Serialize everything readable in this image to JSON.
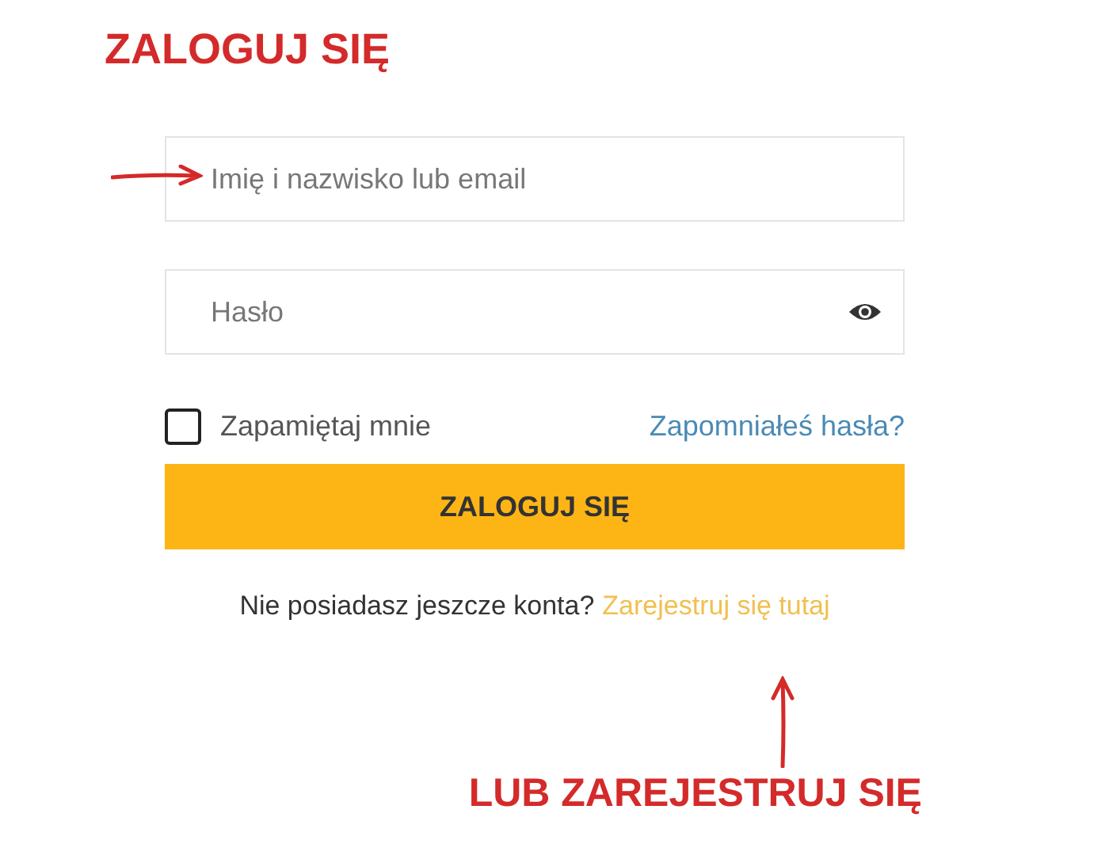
{
  "annotation_heading": "ZALOGUJ SIĘ",
  "fields": [
    {
      "kind": "text",
      "placeholder": "Imię i nazwisko lub email"
    },
    {
      "kind": "password",
      "placeholder": "Hasło"
    }
  ],
  "remember": {
    "label": "Zapamiętaj mnie",
    "checked": false
  },
  "forgot_link": "Zapomniałeś hasła?",
  "login_button": "ZALOGUJ SIĘ",
  "register": {
    "text": "Nie posiadasz jeszcze konta?",
    "link": "Zarejestruj się tutaj"
  },
  "annotation_footer": "LUB ZAREJESTRUJ SIĘ"
}
